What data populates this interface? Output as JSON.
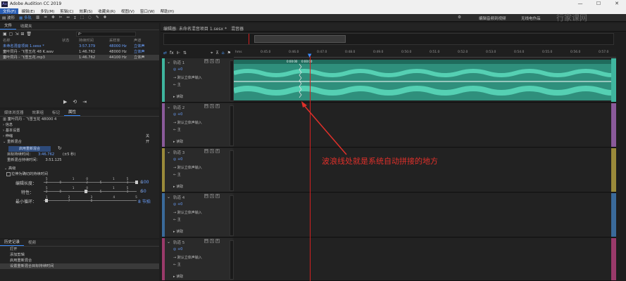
{
  "window": {
    "title": "Adobe Audition CC 2019",
    "app_icon": "Au",
    "minimize": "—",
    "maximize": "☐",
    "close": "✕"
  },
  "menu": [
    "文件(F)",
    "编辑(E)",
    "多轨(M)",
    "剪辑(C)",
    "效果(S)",
    "收藏夹(R)",
    "视图(V)",
    "窗口(W)",
    "帮助(H)"
  ],
  "toolbar": {
    "waveform": "波形",
    "multitrack": "多轨",
    "right1": "编辑音频到视频",
    "right2": "无线电作品",
    "watermark": "行家课网"
  },
  "files": {
    "tab1": "文件",
    "tab2": "收藏夹",
    "search_ph": "ρ-",
    "headers": [
      "名称",
      "状态",
      "持续时间",
      "采样率",
      "声道"
    ],
    "rows": [
      {
        "name": "未命名混音项目 1.sesx *",
        "dur": "3:57.379",
        "rate": "48000 Hz",
        "ch": "立体声",
        "selected": false
      },
      {
        "name": "童叶同丹 - 飞雪玉花 48 K.wav",
        "dur": "1:46.762",
        "rate": "48000 Hz",
        "ch": "立体声",
        "selected": false
      },
      {
        "name": "童叶同丹 - 飞雪玉花.mp3",
        "dur": "1:46.762",
        "rate": "44100 Hz",
        "ch": "立体声",
        "selected": true
      }
    ]
  },
  "props": {
    "tabs": [
      "媒体浏览器",
      "效果组",
      "标记",
      "属性"
    ],
    "file": "童叶同丹 - 飞雪玉花 48000 4",
    "sections": [
      "信息",
      "基本设置",
      "伸缩",
      "重新混合"
    ],
    "stretch_val": "关",
    "remix_val": "开",
    "remix_button": "启用重新混合",
    "target_label": "目标持续时间：",
    "target_value": "3:46.762",
    "target_unit": "(±5 秒)",
    "remix_dur_label": "重新混合持续时间：",
    "remix_dur_value": "3:51.125",
    "advanced": "高级",
    "checkbox": "拉伸为确切的持续时间",
    "sliders": [
      {
        "label": "编辑长度：",
        "ticks": [
          "5",
          "10",
          "15",
          "20",
          "25",
          "30"
        ],
        "value": "100"
      },
      {
        "label": "特性：",
        "ticks": [
          "5",
          "10",
          "15",
          "20",
          "25",
          "30"
        ],
        "value": "50"
      },
      {
        "label": "最小循环：",
        "ticks": [
          "1",
          "2",
          "3",
          "4",
          "5",
          "6",
          "7",
          "8"
        ],
        "value": "8 节拍"
      }
    ]
  },
  "history": {
    "tab1": "历史记录",
    "tab2": "视频",
    "items": [
      "打开",
      "添加剪辑",
      "启用重新混合",
      "设置重新混合目标持续时间"
    ]
  },
  "editor": {
    "tab": "编辑器: 未命名混音项目 1.sesx *",
    "tab2": "混音器",
    "time_labels": [
      "hms",
      "0:45.0",
      "0:46.0",
      "0:47.0",
      "0:48.0",
      "0:49.0",
      "0:50.0",
      "0:51.0",
      "0:52.0",
      "0:53.0",
      "0:54.0",
      "0:55.0",
      "0:56.0",
      "0:57.0",
      "0:58.0"
    ]
  },
  "tracks": [
    {
      "name": "轨道 1",
      "vol": "+0",
      "input": "默认立体声输入",
      "output": "主",
      "mode": "读取",
      "color": "#3fb59e",
      "clip": true
    },
    {
      "name": "轨道 2",
      "vol": "+0",
      "input": "默认立体声输入",
      "output": "主",
      "mode": "读取",
      "color": "#8a5a9a",
      "clip": false
    },
    {
      "name": "轨道 3",
      "vol": "+0",
      "input": "默认立体声输入",
      "output": "主",
      "mode": "读取",
      "color": "#9a8a3a",
      "clip": false
    },
    {
      "name": "轨道 4",
      "vol": "+0",
      "input": "默认立体声输入",
      "output": "主",
      "mode": "读取",
      "color": "#3a6a9a",
      "clip": false
    },
    {
      "name": "轨道 5",
      "vol": "+0",
      "input": "默认立体声输入",
      "output": "主",
      "mode": "读取",
      "color": "#9a3a6a",
      "clip": false
    }
  ],
  "clip_labels": [
    "0:00:00",
    "0:00:00"
  ],
  "annotation": "波浪线处就是系统自动拼接的地方",
  "colors": {
    "accent": "#3a8cff",
    "clip": "#2f8f7c",
    "wave": "#4fd4b4",
    "annot": "#e0302a",
    "playhead": "#d32020"
  }
}
